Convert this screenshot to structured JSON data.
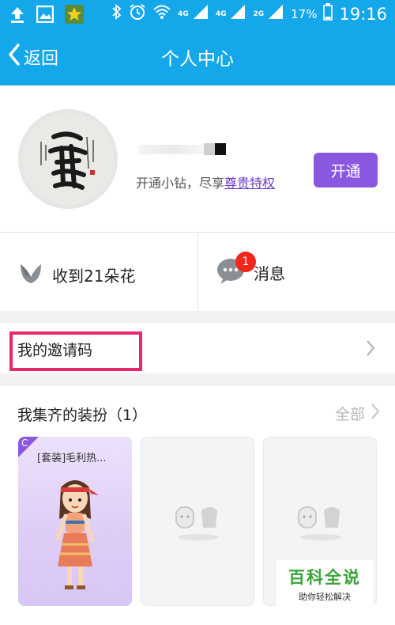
{
  "status_bar": {
    "net_4g": "4G",
    "net_4g_small": "4G",
    "net_2g": "2G",
    "battery_pct": "17%",
    "time": "19:16"
  },
  "nav": {
    "back_label": "返回",
    "title": "个人中心"
  },
  "profile": {
    "subtitle_prefix": "开通小钻，尽享",
    "subtitle_link": "尊贵特权",
    "open_button": "开通"
  },
  "stats": {
    "flowers_label": "收到21朵花",
    "messages_label": "消息",
    "messages_badge": "1"
  },
  "invite": {
    "label": "我的邀请码"
  },
  "collection": {
    "title": "我集齐的装扮（1）",
    "all_label": "全部",
    "cards": [
      {
        "corner": "C",
        "name": "[套装]毛利热..."
      }
    ]
  },
  "watermark": {
    "title": "百科全说",
    "subtitle": "助你轻松解决"
  },
  "colors": {
    "brand_blue": "#14a7ea",
    "purple": "#8a58e0",
    "badge_red": "#f2271c",
    "highlight_pink": "#e8286a"
  }
}
